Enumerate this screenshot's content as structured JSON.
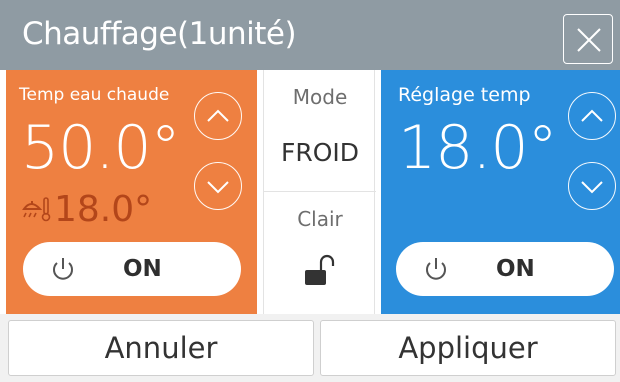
{
  "header": {
    "title": "Chauffage(1unité)",
    "close_icon": "close-icon"
  },
  "hot_water": {
    "label": "Temp eau chaude",
    "temperature": "50.0°",
    "sensor_temperature": "18.0°",
    "sensor_icon": "shower-thermometer-icon",
    "power_label": "ON",
    "accent_color": "#ee8041"
  },
  "mode": {
    "label": "Mode",
    "value": "FROID"
  },
  "lock": {
    "label": "Clair",
    "icon": "unlocked-padlock-icon"
  },
  "setpoint": {
    "label": "Réglage temp",
    "temperature": "18.0°",
    "power_label": "ON",
    "accent_color": "#2b8edc"
  },
  "footer": {
    "cancel_label": "Annuler",
    "apply_label": "Appliquer"
  }
}
